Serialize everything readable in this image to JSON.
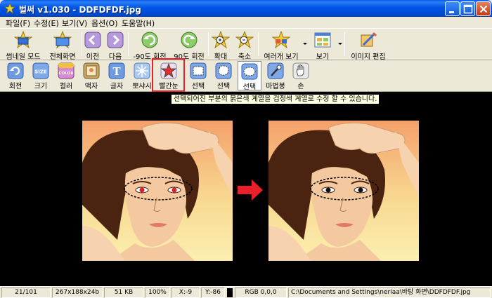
{
  "window": {
    "title": "벌써 v1.030 - DDFDFDF.jpg"
  },
  "menu": [
    "파일(F)",
    "수정(E)",
    "보기(V)",
    "옵션(O)",
    "도움말(H)"
  ],
  "toolbar1": [
    {
      "label": "썸네일 모드",
      "icon": "thumbnail-icon"
    },
    {
      "label": "전체화면",
      "icon": "fullscreen-icon"
    },
    {
      "label": "이전",
      "icon": "previous-icon"
    },
    {
      "label": "다음",
      "icon": "next-icon"
    },
    {
      "label": "-90도 회전",
      "icon": "rotate-left-icon"
    },
    {
      "label": "90도 회전",
      "icon": "rotate-right-icon"
    },
    {
      "label": "확대",
      "icon": "zoom-in-icon"
    },
    {
      "label": "축소",
      "icon": "zoom-out-icon"
    },
    {
      "label": "여러개 보기",
      "icon": "multi-view-icon"
    },
    {
      "label": "보기",
      "icon": "view-icon"
    },
    {
      "label": "이미지 편집",
      "icon": "image-edit-icon"
    }
  ],
  "toolbar2": [
    {
      "label": "회전",
      "icon": "rotate-icon"
    },
    {
      "label": "크기",
      "icon": "size-icon",
      "badge": "SIZE"
    },
    {
      "label": "컬러",
      "icon": "color-icon",
      "badge": "COLOR"
    },
    {
      "label": "액자",
      "icon": "frame-icon"
    },
    {
      "label": "글자",
      "icon": "text-icon",
      "badge": "T"
    },
    {
      "label": "뽀샤시",
      "icon": "soften-icon"
    },
    {
      "label": "빨간눈",
      "icon": "red-eye-icon"
    },
    {
      "label": "선택",
      "icon": "select-rect-icon"
    },
    {
      "label": "선택",
      "icon": "select-round-icon"
    },
    {
      "label": "선택",
      "icon": "select-ellipse-icon"
    },
    {
      "label": "마법봉",
      "icon": "magic-wand-icon"
    },
    {
      "label": "손",
      "icon": "hand-icon"
    }
  ],
  "tooltip": "선택되어진 부분의 붉은색 계열을 검정색 계열로 수정 할 수 있습니다.",
  "status": {
    "index": "21/101",
    "dimensions": "267x188x24b",
    "filesize": "51 KB",
    "zoom": "100%",
    "x": "X:-9",
    "y": "Y:-86",
    "rgb": "RGB 0,0,0",
    "path": "C:\\Documents and Settings\\neriaa\\바탕 화면\\DDFDFDF.jpg"
  },
  "colors": {
    "titlebar": "#0055E5",
    "highlight": "#E8202A",
    "tooltip_bg": "#FFFFE1",
    "viewer_bg": "#000000",
    "arrow": "#E8202A"
  }
}
